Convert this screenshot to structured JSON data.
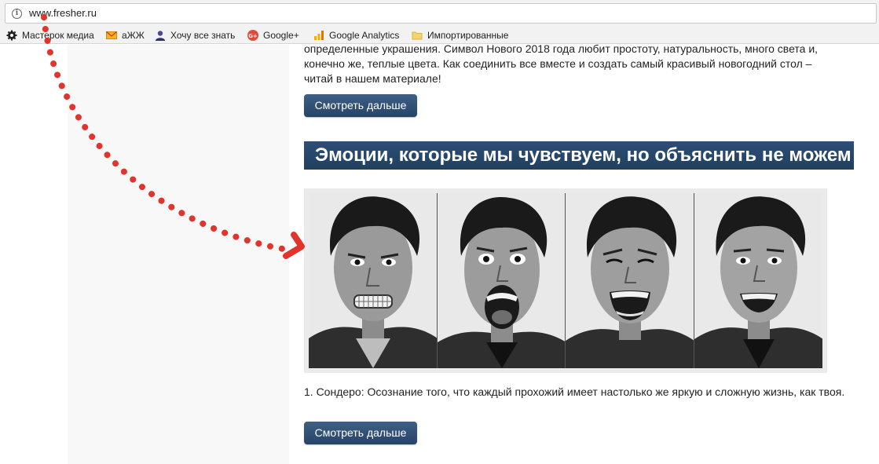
{
  "address_bar": {
    "url": "www.fresher.ru"
  },
  "bookmarks": [
    {
      "label": "Мастерок медиа",
      "icon": "gear-badge-icon"
    },
    {
      "label": "аЖЖ",
      "icon": "envelope-icon"
    },
    {
      "label": "Хочу все знать",
      "icon": "person-icon"
    },
    {
      "label": "Google+",
      "icon": "google-plus-icon"
    },
    {
      "label": "Google Analytics",
      "icon": "analytics-icon"
    },
    {
      "label": "Импортированные",
      "icon": "folder-icon"
    }
  ],
  "article": {
    "intro_text": "определенные украшения. Символ Нового 2018 года любит простоту, натуральность, много света и, конечно же, теплые цвета. Как соединить все вместе и создать самый красивый новогодний стол – читай в нашем материале!",
    "more_button_1": "Смотреть дальше",
    "heading": "Эмоции, которые мы чувствуем, но объяснить не можем",
    "caption": "1. Сондеро: Осознание того, что каждый прохожий имеет настолько же яркую и сложную жизнь, как твоя.",
    "more_button_2": "Смотреть дальше"
  },
  "colors": {
    "button": "#2f4f75",
    "heading_bg": "#264569",
    "arrow": "#e0342c"
  }
}
